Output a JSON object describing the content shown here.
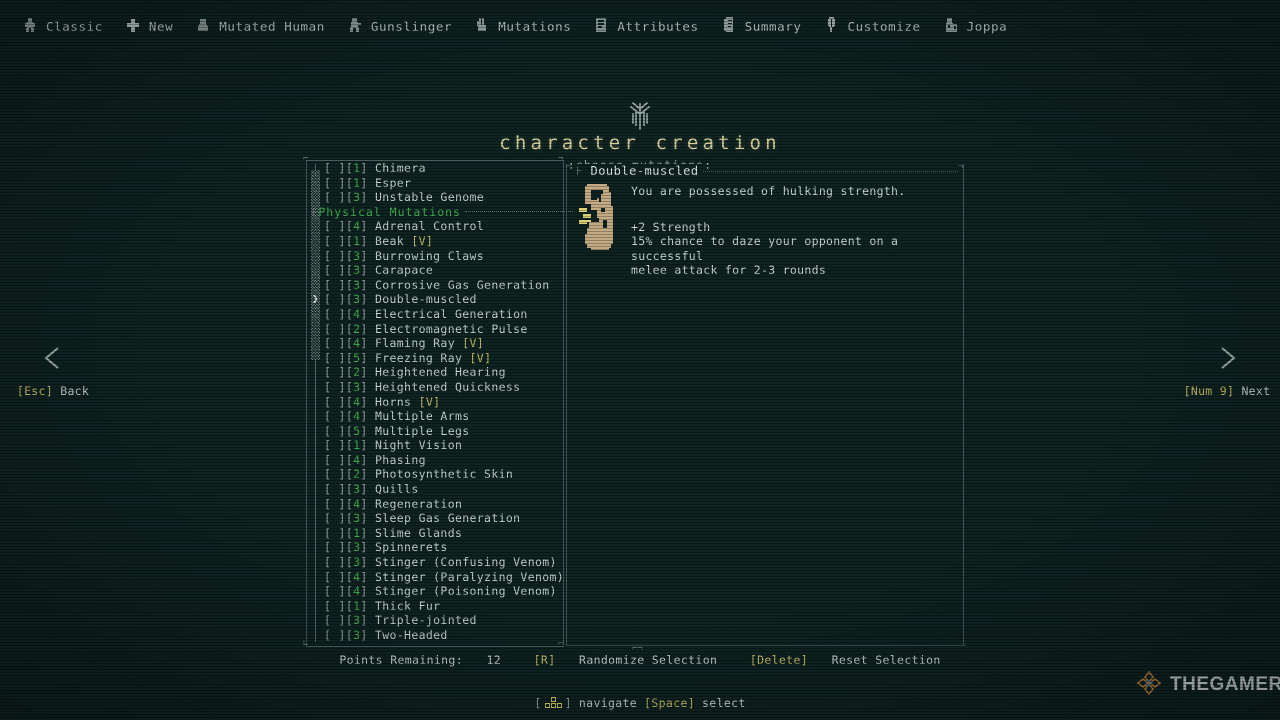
{
  "breadcrumbs": [
    {
      "label": "Classic",
      "icon": "character-icon"
    },
    {
      "label": "New",
      "icon": "plus-icon"
    },
    {
      "label": "Mutated Human",
      "icon": "mutant-icon"
    },
    {
      "label": "Gunslinger",
      "icon": "gunslinger-icon"
    },
    {
      "label": "Mutations",
      "icon": "dna-hand-icon"
    },
    {
      "label": "Attributes",
      "icon": "tablet-icon"
    },
    {
      "label": "Summary",
      "icon": "scroll-icon"
    },
    {
      "label": "Customize",
      "icon": "leaf-icon"
    },
    {
      "label": "Joppa",
      "icon": "village-icon"
    }
  ],
  "header": {
    "title": "character creation",
    "subtitle": ":choose mutations:",
    "sigil": "tree-sigil-icon"
  },
  "colors": {
    "background": "#0b201f",
    "title": "#d6d09a",
    "cost": "#3fae4e",
    "category": "#3fae4e",
    "key_hint": "#c9bf63",
    "text": "#c6d2d0",
    "border": "#46595b"
  },
  "list": {
    "scrollbar": {
      "thumb_top_pct": 1,
      "thumb_height_pct": 40
    },
    "rows": [
      {
        "type": "item",
        "checkbox": "[ ]",
        "cost": "1",
        "name": "Chimera",
        "tag": "",
        "selected": false
      },
      {
        "type": "item",
        "checkbox": "[ ]",
        "cost": "1",
        "name": "Esper",
        "tag": "",
        "selected": false
      },
      {
        "type": "item",
        "checkbox": "[ ]",
        "cost": "3",
        "name": "Unstable Genome",
        "tag": "",
        "selected": false
      },
      {
        "type": "header",
        "name": "Physical Mutations"
      },
      {
        "type": "item",
        "checkbox": "[ ]",
        "cost": "4",
        "name": "Adrenal Control",
        "tag": "",
        "selected": false
      },
      {
        "type": "item",
        "checkbox": "[ ]",
        "cost": "1",
        "name": "Beak",
        "tag": "[V]",
        "selected": false
      },
      {
        "type": "item",
        "checkbox": "[ ]",
        "cost": "3",
        "name": "Burrowing Claws",
        "tag": "",
        "selected": false
      },
      {
        "type": "item",
        "checkbox": "[ ]",
        "cost": "3",
        "name": "Carapace",
        "tag": "",
        "selected": false
      },
      {
        "type": "item",
        "checkbox": "[ ]",
        "cost": "3",
        "name": "Corrosive Gas Generation",
        "tag": "",
        "selected": false
      },
      {
        "type": "item",
        "checkbox": "[ ]",
        "cost": "3",
        "name": "Double-muscled",
        "tag": "",
        "selected": true
      },
      {
        "type": "item",
        "checkbox": "[ ]",
        "cost": "4",
        "name": "Electrical Generation",
        "tag": "",
        "selected": false
      },
      {
        "type": "item",
        "checkbox": "[ ]",
        "cost": "2",
        "name": "Electromagnetic Pulse",
        "tag": "",
        "selected": false
      },
      {
        "type": "item",
        "checkbox": "[ ]",
        "cost": "4",
        "name": "Flaming Ray",
        "tag": "[V]",
        "selected": false
      },
      {
        "type": "item",
        "checkbox": "[ ]",
        "cost": "5",
        "name": "Freezing Ray",
        "tag": "[V]",
        "selected": false
      },
      {
        "type": "item",
        "checkbox": "[ ]",
        "cost": "2",
        "name": "Heightened Hearing",
        "tag": "",
        "selected": false
      },
      {
        "type": "item",
        "checkbox": "[ ]",
        "cost": "3",
        "name": "Heightened Quickness",
        "tag": "",
        "selected": false
      },
      {
        "type": "item",
        "checkbox": "[ ]",
        "cost": "4",
        "name": "Horns",
        "tag": "[V]",
        "selected": false
      },
      {
        "type": "item",
        "checkbox": "[ ]",
        "cost": "4",
        "name": "Multiple Arms",
        "tag": "",
        "selected": false
      },
      {
        "type": "item",
        "checkbox": "[ ]",
        "cost": "5",
        "name": "Multiple Legs",
        "tag": "",
        "selected": false
      },
      {
        "type": "item",
        "checkbox": "[ ]",
        "cost": "1",
        "name": "Night Vision",
        "tag": "",
        "selected": false
      },
      {
        "type": "item",
        "checkbox": "[ ]",
        "cost": "4",
        "name": "Phasing",
        "tag": "",
        "selected": false
      },
      {
        "type": "item",
        "checkbox": "[ ]",
        "cost": "2",
        "name": "Photosynthetic Skin",
        "tag": "",
        "selected": false
      },
      {
        "type": "item",
        "checkbox": "[ ]",
        "cost": "3",
        "name": "Quills",
        "tag": "",
        "selected": false
      },
      {
        "type": "item",
        "checkbox": "[ ]",
        "cost": "4",
        "name": "Regeneration",
        "tag": "",
        "selected": false
      },
      {
        "type": "item",
        "checkbox": "[ ]",
        "cost": "3",
        "name": "Sleep Gas Generation",
        "tag": "",
        "selected": false
      },
      {
        "type": "item",
        "checkbox": "[ ]",
        "cost": "1",
        "name": "Slime Glands",
        "tag": "",
        "selected": false
      },
      {
        "type": "item",
        "checkbox": "[ ]",
        "cost": "3",
        "name": "Spinnerets",
        "tag": "",
        "selected": false
      },
      {
        "type": "item",
        "checkbox": "[ ]",
        "cost": "3",
        "name": "Stinger (Confusing Venom)",
        "tag": "",
        "selected": false
      },
      {
        "type": "item",
        "checkbox": "[ ]",
        "cost": "4",
        "name": "Stinger (Paralyzing Venom)",
        "tag": "",
        "selected": false
      },
      {
        "type": "item",
        "checkbox": "[ ]",
        "cost": "4",
        "name": "Stinger (Poisoning Venom)",
        "tag": "",
        "selected": false
      },
      {
        "type": "item",
        "checkbox": "[ ]",
        "cost": "1",
        "name": "Thick Fur",
        "tag": "",
        "selected": false
      },
      {
        "type": "item",
        "checkbox": "[ ]",
        "cost": "3",
        "name": "Triple-jointed",
        "tag": "",
        "selected": false
      },
      {
        "type": "item",
        "checkbox": "[ ]",
        "cost": "3",
        "name": "Two-Headed",
        "tag": "",
        "selected": false
      }
    ]
  },
  "detail": {
    "title": "Double-muscled",
    "icon": "flexed-arm-icon",
    "flavor": "You are possessed of hulking strength.",
    "stats": [
      "+2 Strength",
      "15% chance to daze your opponent on a successful",
      "melee attack for 2-3 rounds"
    ]
  },
  "nav": {
    "back_key": "[Esc]",
    "back_label": "Back",
    "next_key": "[Num 9]",
    "next_label": "Next"
  },
  "status": {
    "points_label": "Points Remaining:",
    "points_value": "12",
    "randomize_key": "[R]",
    "randomize_label": "Randomize Selection",
    "reset_key": "[Delete]",
    "reset_label": "Reset Selection"
  },
  "footer": {
    "navigate_icon": "arrow-keys-icon",
    "navigate_label": "navigate",
    "select_key": "[Space]",
    "select_label": "select"
  },
  "watermark": {
    "text": "THEGAMER",
    "icon": "thegamer-logo-icon"
  }
}
